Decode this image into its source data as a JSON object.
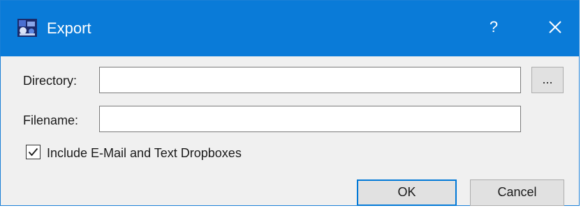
{
  "window": {
    "title": "Export",
    "help_label": "?",
    "icons": {
      "app": "export-app-icon",
      "close": "close-icon"
    }
  },
  "form": {
    "directory": {
      "label": "Directory:",
      "value": "",
      "browse_label": "..."
    },
    "filename": {
      "label": "Filename:",
      "value": ""
    },
    "include_dropboxes": {
      "label": "Include E-Mail and Text Dropboxes",
      "checked": true
    }
  },
  "buttons": {
    "ok_label": "OK",
    "cancel_label": "Cancel"
  },
  "colors": {
    "titlebar": "#0a7bd8",
    "accent": "#0078d7",
    "dialog_bg": "#f0f0f0"
  }
}
